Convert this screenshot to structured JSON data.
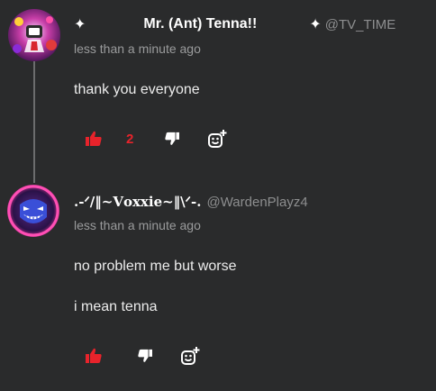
{
  "comments": [
    {
      "display_name": "Mr. (Ant) Tenna!!",
      "prefix_sparkle": "✦",
      "handle_sparkle": "✦",
      "handle": "@TV_TIME",
      "timestamp": "less than a minute ago",
      "body_lines": [
        "thank you everyone"
      ],
      "like_count": "2",
      "avatar_icon": "tv-head-avatar"
    },
    {
      "display_name": ".-ᐟ/‖~𝐕𝐨𝐱𝐱𝐢𝐞~‖\\ᐟ-.",
      "handle": "@WardenPlayz4",
      "timestamp": "less than a minute ago",
      "body_lines": [
        "no problem me but worse",
        "i mean tenna"
      ],
      "like_count": "",
      "avatar_icon": "grinning-demon-avatar"
    }
  ],
  "colors": {
    "background": "#2a2b2c",
    "like_active": "#e8232b",
    "icon": "#ffffff",
    "muted_text": "#9a9b9c"
  }
}
